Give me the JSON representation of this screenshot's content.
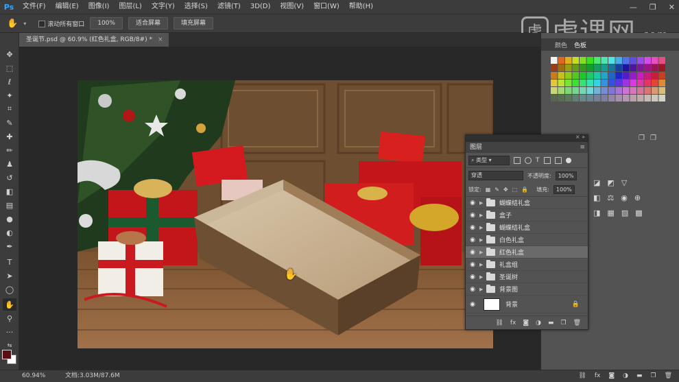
{
  "app": {
    "logo": "Ps"
  },
  "menu": [
    "文件(F)",
    "编辑(E)",
    "图像(I)",
    "图层(L)",
    "文字(Y)",
    "选择(S)",
    "滤镜(T)",
    "3D(D)",
    "视图(V)",
    "窗口(W)",
    "帮助(H)"
  ],
  "window_controls": {
    "minimize": "—",
    "restore": "❐",
    "close": "✕"
  },
  "options": {
    "scroll_all_label": "滚动所有窗口",
    "zoom_value": "100%",
    "fit_screen": "适合屏幕",
    "fill_screen": "填充屏幕"
  },
  "watermark": {
    "text": "虎课网",
    "domain": ".com"
  },
  "document": {
    "tab_title": "圣诞节.psd @ 60.9% (红色礼盒, RGB/8#) *",
    "close": "×"
  },
  "status": {
    "zoom": "60.94%",
    "doc_info": "文档:3.03M/87.6M"
  },
  "panels": {
    "swatch_tabs": [
      "颜色",
      "色板"
    ],
    "layers": {
      "title": "图层",
      "filter_kind": "类型",
      "blend_mode": "穿透",
      "opacity_label": "不透明度:",
      "opacity_value": "100%",
      "lock_label": "锁定:",
      "fill_label": "填充:",
      "fill_value": "100%",
      "items": [
        {
          "name": "蝴蝶结礼盒",
          "type": "group",
          "visible": true,
          "selected": false
        },
        {
          "name": "盒子",
          "type": "group",
          "visible": true,
          "selected": false
        },
        {
          "name": "蝴蝶结礼盒",
          "type": "group",
          "visible": true,
          "selected": false
        },
        {
          "name": "白色礼盒",
          "type": "group",
          "visible": true,
          "selected": false
        },
        {
          "name": "红色礼盒",
          "type": "group",
          "visible": true,
          "selected": true
        },
        {
          "name": "礼盒组",
          "type": "group",
          "visible": true,
          "selected": false
        },
        {
          "name": "圣诞树",
          "type": "group",
          "visible": true,
          "selected": false
        },
        {
          "name": "背景图",
          "type": "group",
          "visible": true,
          "selected": false
        },
        {
          "name": "背景",
          "type": "background",
          "visible": true,
          "selected": false
        }
      ]
    }
  },
  "colors": {
    "foreground": "#5a0f14",
    "background": "#ffffff",
    "accent": "#31a8ff"
  }
}
